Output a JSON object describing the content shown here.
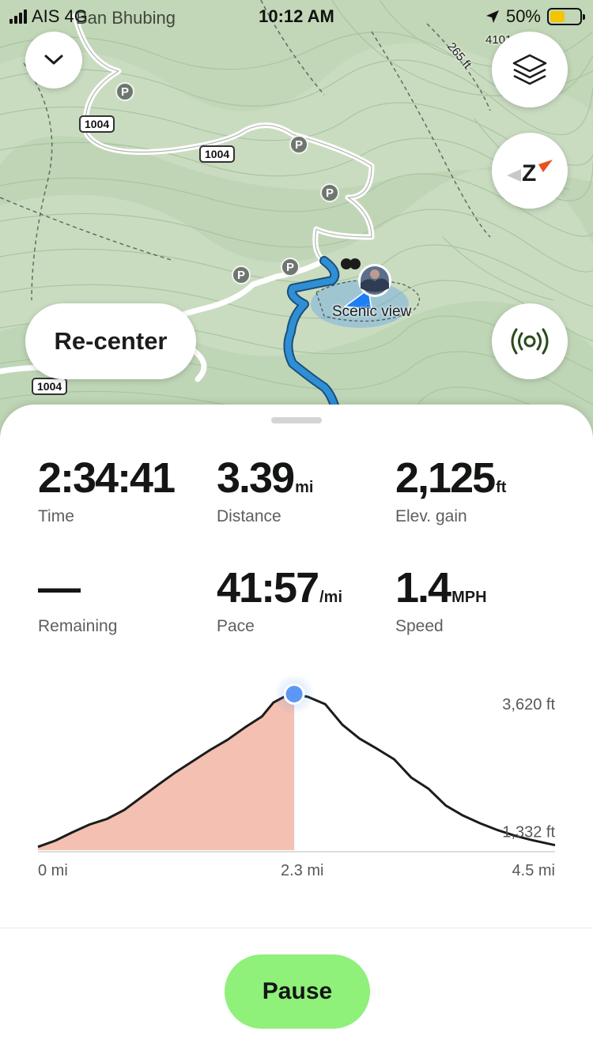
{
  "status_bar": {
    "carrier": "AIS",
    "network": "4G",
    "location_overlay": "Ban Bhubing",
    "time": "10:12 AM",
    "battery": "50%",
    "battery_level": 0.5,
    "battery_color": "#f5c400"
  },
  "map": {
    "road_badges": [
      "1004",
      "1004",
      "1004"
    ],
    "poi_label": "Scenic view",
    "contour_labels": [
      "4101",
      "265 ft"
    ],
    "colors": {
      "terrain": "#c9dcc0",
      "track": "#2f8fd4"
    }
  },
  "map_controls": {
    "collapse_icon": "chevron-down-icon",
    "layers_icon": "layers-icon",
    "compass_icon": "compass-icon",
    "broadcast_icon": "live-broadcast-icon",
    "recenter_label": "Re-center"
  },
  "stats": [
    {
      "value": "2:34:41",
      "unit": "",
      "label": "Time"
    },
    {
      "value": "3.39",
      "unit": "mi",
      "label": "Distance"
    },
    {
      "value": "2,125",
      "unit": "ft",
      "label": "Elev. gain"
    },
    {
      "value": "—",
      "unit": "",
      "label": "Remaining"
    },
    {
      "value": "41:57",
      "unit": "/mi",
      "label": "Pace"
    },
    {
      "value": "1.4",
      "unit": "MPH",
      "label": "Speed"
    }
  ],
  "chart_data": {
    "type": "area",
    "x_unit": "mi",
    "y_unit": "ft",
    "xlim": [
      0,
      4.5
    ],
    "ylim": [
      1000,
      3750
    ],
    "x_tick_labels": [
      "0 mi",
      "2.3 mi",
      "4.5 mi"
    ],
    "y_tick_labels": [
      "3,620 ft",
      "1,332 ft"
    ],
    "y_ticks": [
      3620,
      1332
    ],
    "current_position_mi": 2.23,
    "fill_color": "#f3c0b1",
    "line_color": "#1b1d1b",
    "marker_color": "#5b98f5",
    "x": [
      0,
      0.15,
      0.3,
      0.45,
      0.6,
      0.75,
      0.9,
      1.05,
      1.2,
      1.35,
      1.5,
      1.65,
      1.8,
      1.95,
      2.05,
      2.15,
      2.23,
      2.35,
      2.5,
      2.65,
      2.8,
      2.95,
      3.1,
      3.25,
      3.4,
      3.55,
      3.7,
      3.85,
      4.0,
      4.15,
      4.3,
      4.5
    ],
    "y": [
      1060,
      1170,
      1320,
      1460,
      1560,
      1720,
      1950,
      2180,
      2400,
      2600,
      2800,
      2980,
      3200,
      3400,
      3650,
      3760,
      3800,
      3750,
      3620,
      3250,
      3000,
      2820,
      2630,
      2300,
      2100,
      1800,
      1620,
      1480,
      1360,
      1260,
      1180,
      1090
    ]
  },
  "bottom": {
    "pause_label": "Pause"
  }
}
